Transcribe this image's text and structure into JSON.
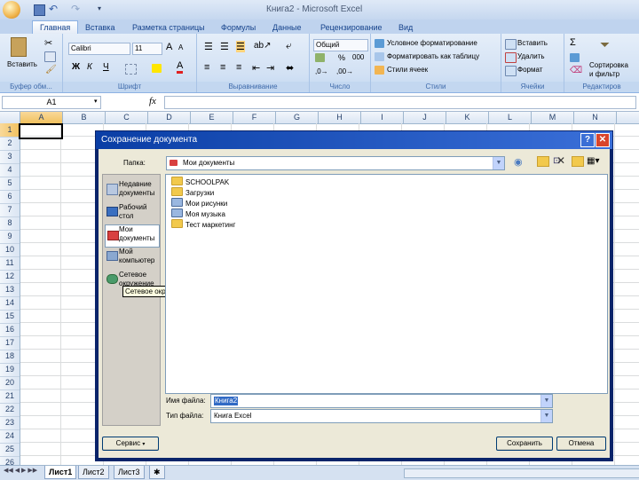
{
  "window": {
    "title": "Книга2 - Microsoft Excel"
  },
  "ribbon": {
    "tabs": [
      "Главная",
      "Вставка",
      "Разметка страницы",
      "Формулы",
      "Данные",
      "Рецензирование",
      "Вид"
    ],
    "clipboard": {
      "paste": "Вставить",
      "label": "Буфер обм..."
    },
    "font": {
      "name": "Calibri",
      "size": "11",
      "label": "Шрифт",
      "bold": "Ж",
      "italic": "К",
      "underline": "Ч",
      "grow": "A",
      "shrink": "A",
      "color": "A"
    },
    "alignment": {
      "label": "Выравнивание"
    },
    "number": {
      "format": "Общий",
      "percent": "%",
      "thousands": "000",
      "label": "Число"
    },
    "styles": {
      "conditional": "Условное форматирование",
      "as_table": "Форматировать как таблицу",
      "cell_styles": "Стили ячеек",
      "label": "Стили"
    },
    "cells": {
      "insert": "Вставить",
      "delete": "Удалить",
      "format": "Формат",
      "label": "Ячейки"
    },
    "editing": {
      "sort": "Сортировка",
      "filter": "и фильтр",
      "label": "Редактиров"
    }
  },
  "formula_bar": {
    "name_box": "A1",
    "fx": "fx",
    "value": ""
  },
  "sheet": {
    "columns": [
      "A",
      "B",
      "C",
      "D",
      "E",
      "F",
      "G",
      "H",
      "I",
      "J",
      "K",
      "L",
      "M",
      "N"
    ],
    "rows": [
      "1",
      "2",
      "3",
      "4",
      "5",
      "6",
      "7",
      "8",
      "9",
      "10",
      "11",
      "12",
      "13",
      "14",
      "15",
      "16",
      "17",
      "18",
      "19",
      "20",
      "21",
      "22",
      "23",
      "24",
      "25",
      "26"
    ],
    "tabs": [
      "Лист1",
      "Лист2",
      "Лист3"
    ]
  },
  "dialog": {
    "title": "Сохранение документа",
    "folder_label": "Папка:",
    "folder_value": "Мои документы",
    "places": [
      {
        "label": "Недавние документы",
        "icon": "recent-docs-icon"
      },
      {
        "label": "Рабочий стол",
        "icon": "desktop-icon"
      },
      {
        "label": "Мои документы",
        "icon": "my-documents-icon"
      },
      {
        "label": "Мой компьютер",
        "icon": "my-computer-icon"
      },
      {
        "label": "Сетевое окружение",
        "icon": "network-icon"
      }
    ],
    "tooltip": "Сетевое окружение",
    "files": [
      {
        "name": "SCHOOLPAK",
        "icon": "folder-icon"
      },
      {
        "name": "Загрузки",
        "icon": "folder-icon"
      },
      {
        "name": "Мои рисунки",
        "icon": "pictures-folder-icon"
      },
      {
        "name": "Моя музыка",
        "icon": "music-folder-icon"
      },
      {
        "name": "Тест маркетинг",
        "icon": "folder-icon"
      }
    ],
    "filename_label": "Имя файла:",
    "filename_value": "Книга2",
    "filetype_label": "Тип файла:",
    "filetype_value": "Книга Excel",
    "service_button": "Сервис",
    "save_button": "Сохранить",
    "cancel_button": "Отмена"
  }
}
